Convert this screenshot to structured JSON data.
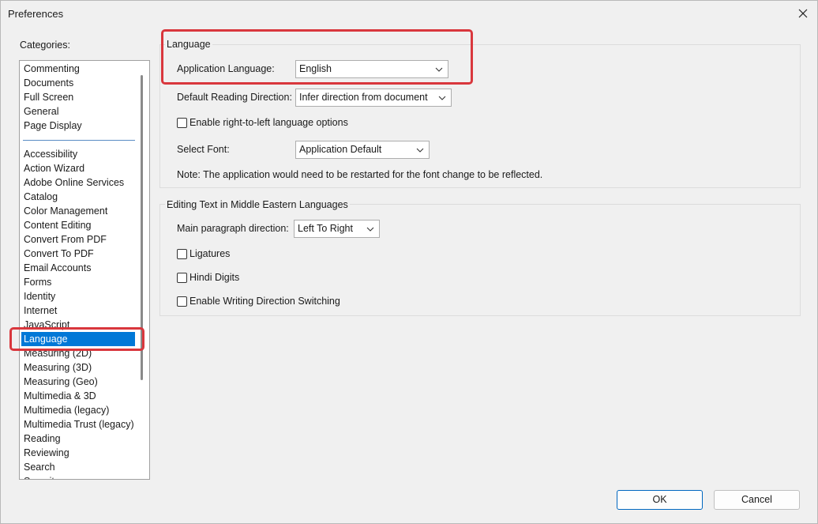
{
  "window": {
    "title": "Preferences"
  },
  "categories": {
    "label": "Categories:",
    "top_items": [
      "Commenting",
      "Documents",
      "Full Screen",
      "General",
      "Page Display"
    ],
    "items": [
      "Accessibility",
      "Action Wizard",
      "Adobe Online Services",
      "Catalog",
      "Color Management",
      "Content Editing",
      "Convert From PDF",
      "Convert To PDF",
      "Email Accounts",
      "Forms",
      "Identity",
      "Internet",
      "JavaScript",
      "Language",
      "Measuring (2D)",
      "Measuring (3D)",
      "Measuring (Geo)",
      "Multimedia & 3D",
      "Multimedia (legacy)",
      "Multimedia Trust (legacy)",
      "Reading",
      "Reviewing",
      "Search",
      "Security"
    ],
    "selected": "Language"
  },
  "language_group": {
    "title": "Language",
    "app_language_label": "Application Language:",
    "app_language_value": "English",
    "reading_direction_label": "Default Reading Direction:",
    "reading_direction_value": "Infer direction from document",
    "rtl_checkbox_label": "Enable right-to-left language options",
    "select_font_label": "Select Font:",
    "select_font_value": "Application Default",
    "note": "Note: The application would need to be restarted for the font change to be reflected."
  },
  "middle_eastern_group": {
    "title": "Editing Text in Middle Eastern Languages",
    "paragraph_direction_label": "Main paragraph direction:",
    "paragraph_direction_value": "Left To Right",
    "ligatures_label": "Ligatures",
    "hindi_digits_label": "Hindi Digits",
    "writing_direction_label": "Enable Writing Direction Switching"
  },
  "buttons": {
    "ok": "OK",
    "cancel": "Cancel"
  },
  "colors": {
    "highlight": "#d9373d",
    "selection": "#0078d7"
  }
}
